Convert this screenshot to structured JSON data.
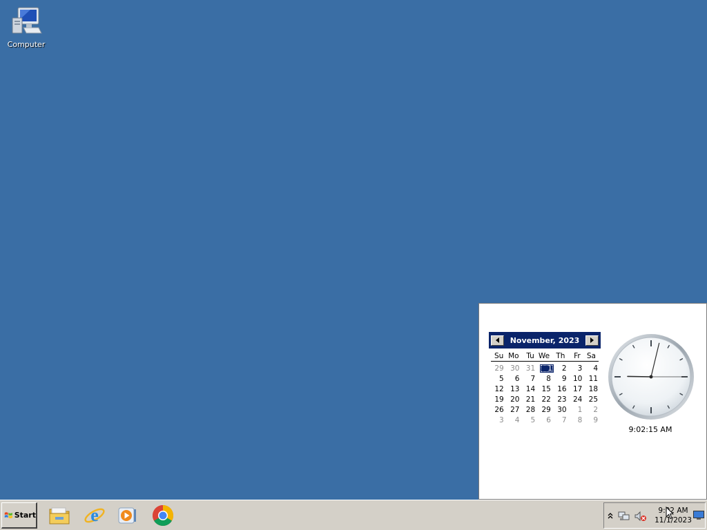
{
  "desktop": {
    "icons": [
      {
        "label": "Computer",
        "icon": "computer-icon"
      }
    ]
  },
  "calendar": {
    "month_label": "November, 2023",
    "day_headers": [
      "Su",
      "Mo",
      "Tu",
      "We",
      "Th",
      "Fr",
      "Sa"
    ],
    "weeks": [
      [
        {
          "d": "29",
          "m": true
        },
        {
          "d": "30",
          "m": true
        },
        {
          "d": "31",
          "m": true
        },
        {
          "d": "1",
          "sel": true
        },
        {
          "d": "2"
        },
        {
          "d": "3"
        },
        {
          "d": "4"
        }
      ],
      [
        {
          "d": "5"
        },
        {
          "d": "6"
        },
        {
          "d": "7"
        },
        {
          "d": "8"
        },
        {
          "d": "9"
        },
        {
          "d": "10"
        },
        {
          "d": "11"
        }
      ],
      [
        {
          "d": "12"
        },
        {
          "d": "13"
        },
        {
          "d": "14"
        },
        {
          "d": "15"
        },
        {
          "d": "16"
        },
        {
          "d": "17"
        },
        {
          "d": "18"
        }
      ],
      [
        {
          "d": "19"
        },
        {
          "d": "20"
        },
        {
          "d": "21"
        },
        {
          "d": "22"
        },
        {
          "d": "23"
        },
        {
          "d": "24"
        },
        {
          "d": "25"
        }
      ],
      [
        {
          "d": "26"
        },
        {
          "d": "27"
        },
        {
          "d": "28"
        },
        {
          "d": "29"
        },
        {
          "d": "30"
        },
        {
          "d": "1",
          "m": true
        },
        {
          "d": "2",
          "m": true
        }
      ],
      [
        {
          "d": "3",
          "m": true
        },
        {
          "d": "4",
          "m": true
        },
        {
          "d": "5",
          "m": true
        },
        {
          "d": "6",
          "m": true
        },
        {
          "d": "7",
          "m": true
        },
        {
          "d": "8",
          "m": true
        },
        {
          "d": "9",
          "m": true
        }
      ]
    ],
    "selected_day": "1"
  },
  "clock": {
    "digital_time": "9:02:15 AM",
    "hour": 9,
    "minute": 2,
    "second": 15
  },
  "taskbar": {
    "start_label": "Start",
    "pinned": [
      "file-explorer-icon",
      "internet-explorer-icon",
      "media-player-icon",
      "chrome-icon"
    ],
    "tray": {
      "time": "9:02 AM",
      "date": "11/1/2023",
      "icons": [
        "show-hidden-icons-chevron",
        "network-icon",
        "volume-muted-icon",
        "show-desktop-icon"
      ]
    }
  },
  "colors": {
    "desktop_bg": "#3a6ea5",
    "calendar_header": "#0a246a",
    "taskbar_bg": "#d4d0c8"
  }
}
